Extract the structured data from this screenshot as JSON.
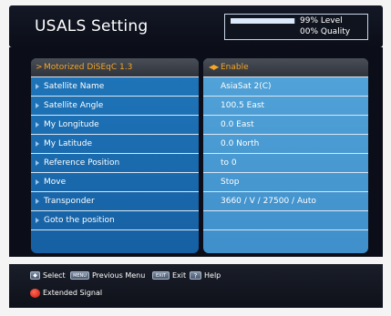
{
  "header": {
    "title": "USALS Setting",
    "level": {
      "percent_text": "99%",
      "label": "Level",
      "fraction": 0.99
    },
    "quality": {
      "percent_text": "00%",
      "label": "Quality",
      "fraction": 0.0
    }
  },
  "menu": {
    "rows": [
      {
        "label": "Motorized DiSEqC 1.3",
        "value": "Enable",
        "selected": true
      },
      {
        "label": "Satellite Name",
        "value": "AsiaSat 2(C)"
      },
      {
        "label": "Satellite Angle",
        "value": "100.5 East"
      },
      {
        "label": "My Longitude",
        "value": "0.0 East"
      },
      {
        "label": "My Latitude",
        "value": "0.0 North"
      },
      {
        "label": "Reference Position",
        "value": "to 0"
      },
      {
        "label": "Move",
        "value": "Stop"
      },
      {
        "label": "Transponder",
        "value": "3660 / V / 27500 / Auto"
      },
      {
        "label": "Goto the position",
        "value": ""
      }
    ]
  },
  "footer": {
    "select_label": "Select",
    "menu_key": "MENU",
    "previous_menu_label": "Previous Menu",
    "exit_key": "EXIT",
    "exit_label": "Exit",
    "help_key": "?",
    "help_label": "Help",
    "extended_signal_label": "Extended Signal"
  },
  "colors": {
    "accent": "#f4a524",
    "left_panel": "#1f76ba",
    "right_panel": "#4b9cd4",
    "background": "#0b0e18"
  }
}
